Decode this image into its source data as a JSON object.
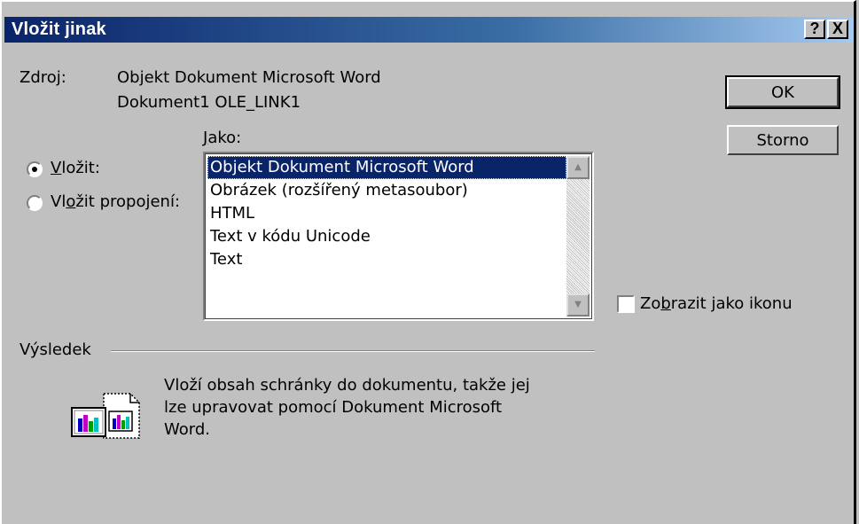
{
  "window": {
    "title": "Vložit jinak",
    "help_label": "?",
    "close_label": "X"
  },
  "source": {
    "label": "Zdroj:",
    "line1": "Objekt Dokument Microsoft Word",
    "line2": "Dokument1 OLE_LINK1"
  },
  "as": {
    "label": "Jako:",
    "items": [
      "Objekt Dokument Microsoft Word",
      "Obrázek (rozšířený metasoubor)",
      "HTML",
      "Text v kódu Unicode",
      "Text"
    ],
    "selected_index": 0
  },
  "mode": {
    "paste_label": "Vložit:",
    "paste_link_label": "Vložit propojení:",
    "selected": "paste"
  },
  "buttons": {
    "ok": "OK",
    "cancel": "Storno"
  },
  "display_as_icon": {
    "label": "Zobrazit jako ikonu",
    "checked": false
  },
  "result": {
    "label": "Výsledek",
    "line1": "Vloží obsah schránky do dokumentu, takže jej",
    "line2": "lze upravovat pomocí Dokument Microsoft",
    "line3": "Word."
  },
  "colors": {
    "title_bar_start": "#0a246a",
    "title_bar_end": "#a6caf0",
    "dialog_background": "#c0c0c0",
    "selection": "#0a246a"
  },
  "icons": {
    "result_icon": "document-paste-chart-icon",
    "scroll_up": "scroll-up-arrow-icon",
    "scroll_down": "scroll-down-arrow-icon"
  }
}
